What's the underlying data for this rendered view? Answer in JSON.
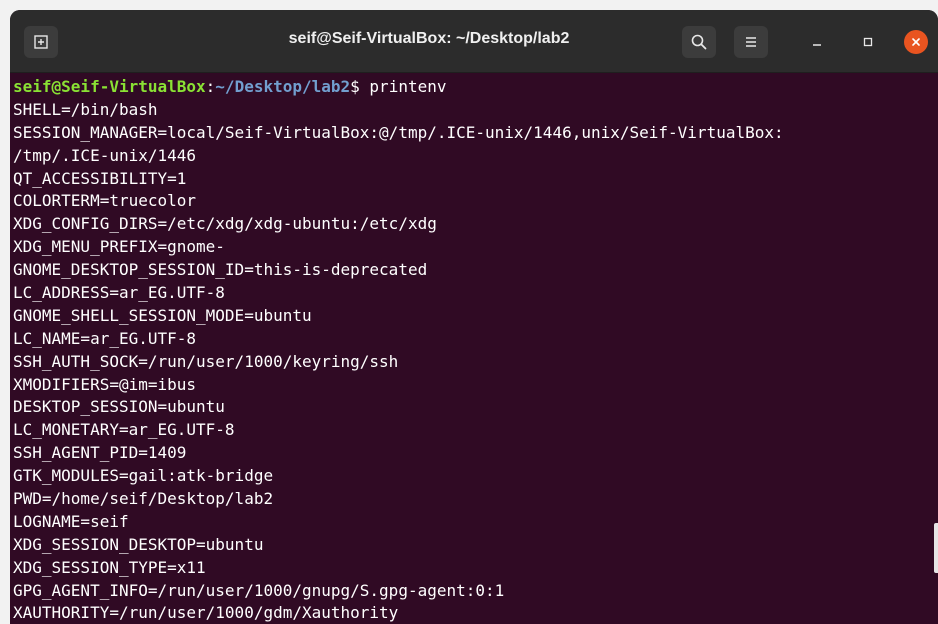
{
  "window": {
    "title": "seif@Seif-VirtualBox: ~/Desktop/lab2"
  },
  "colors": {
    "terminal_bg": "#300a24",
    "titlebar_bg": "#2c2c2c",
    "prompt_user": "#8ae234",
    "prompt_path": "#729fcf",
    "close_button": "#e95420"
  },
  "icons": {
    "new_tab": "new-tab-icon",
    "search": "search-icon",
    "menu": "hamburger-menu-icon",
    "minimize": "minimize-icon",
    "maximize": "maximize-icon",
    "close": "close-icon"
  },
  "prompt": {
    "user_host": "seif@Seif-VirtualBox",
    "colon": ":",
    "path": "~/Desktop/lab2",
    "symbol": "$ ",
    "command": "printenv"
  },
  "output": [
    "SHELL=/bin/bash",
    "SESSION_MANAGER=local/Seif-VirtualBox:@/tmp/.ICE-unix/1446,unix/Seif-VirtualBox:",
    "/tmp/.ICE-unix/1446",
    "QT_ACCESSIBILITY=1",
    "COLORTERM=truecolor",
    "XDG_CONFIG_DIRS=/etc/xdg/xdg-ubuntu:/etc/xdg",
    "XDG_MENU_PREFIX=gnome-",
    "GNOME_DESKTOP_SESSION_ID=this-is-deprecated",
    "LC_ADDRESS=ar_EG.UTF-8",
    "GNOME_SHELL_SESSION_MODE=ubuntu",
    "LC_NAME=ar_EG.UTF-8",
    "SSH_AUTH_SOCK=/run/user/1000/keyring/ssh",
    "XMODIFIERS=@im=ibus",
    "DESKTOP_SESSION=ubuntu",
    "LC_MONETARY=ar_EG.UTF-8",
    "SSH_AGENT_PID=1409",
    "GTK_MODULES=gail:atk-bridge",
    "PWD=/home/seif/Desktop/lab2",
    "LOGNAME=seif",
    "XDG_SESSION_DESKTOP=ubuntu",
    "XDG_SESSION_TYPE=x11",
    "GPG_AGENT_INFO=/run/user/1000/gnupg/S.gpg-agent:0:1",
    "XAUTHORITY=/run/user/1000/gdm/Xauthority"
  ]
}
